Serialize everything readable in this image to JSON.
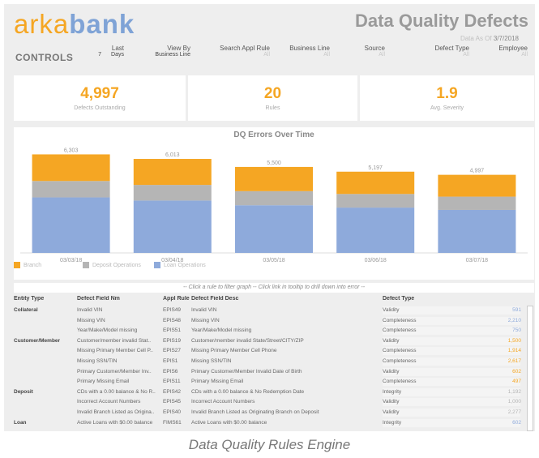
{
  "brand": {
    "part1": "arka",
    "part2": "bank"
  },
  "header": {
    "title": "Data Quality Defects",
    "asof_label": "Data As Of",
    "asof_value": "3/7/2018"
  },
  "controls": {
    "label": "CONTROLS",
    "last": {
      "label": "Last",
      "num": "7",
      "value": "Days"
    },
    "view_by": {
      "label": "View By",
      "value": "Business Line"
    },
    "search_rule": {
      "label": "Search Appl Rule",
      "value": "All"
    },
    "business_line": {
      "label": "Business Line",
      "value": "All"
    },
    "source": {
      "label": "Source",
      "value": "All"
    },
    "defect_type": {
      "label": "Defect Type",
      "value": "All"
    },
    "employee": {
      "label": "Employee",
      "value": "All"
    }
  },
  "kpis": [
    {
      "value": "4,997",
      "label": "Defects Outstanding"
    },
    {
      "value": "20",
      "label": "Rules"
    },
    {
      "value": "1.9",
      "label": "Avg. Severity"
    }
  ],
  "chart_data": {
    "type": "bar",
    "stacked": true,
    "title": "DQ Errors Over Time",
    "categories": [
      "03/03/18",
      "03/04/18",
      "03/05/18",
      "03/06/18",
      "03/07/18"
    ],
    "totals": [
      "6,303",
      "6,013",
      "5,500",
      "5,197",
      "4,997"
    ],
    "series": [
      {
        "name": "Loan Operations",
        "color": "#8eaadb",
        "values": [
          3550,
          3350,
          3050,
          2900,
          2750
        ]
      },
      {
        "name": "Deposit Operations",
        "color": "#b5b5b5",
        "values": [
          1050,
          1000,
          900,
          870,
          850
        ]
      },
      {
        "name": "Branch",
        "color": "#f5a623",
        "values": [
          1703,
          1663,
          1550,
          1427,
          1397
        ]
      }
    ],
    "ylim": [
      0,
      7000
    ]
  },
  "hint": "-- Click a rule to filter graph -- Click link in tooltip to drill down into error --",
  "table": {
    "headers": [
      "Entity Type",
      "Defect Field Nm",
      "Appl Rule",
      "Defect Field Desc",
      "Defect Type"
    ],
    "rows": [
      {
        "entity": "Collateral",
        "field": "Invalid VIN",
        "rule": "EPIS49",
        "desc": "Invalid VIN",
        "type": "Validity",
        "value": "591",
        "color": "#8eaadb",
        "frac": 0.12
      },
      {
        "entity": "",
        "field": "Missing VIN",
        "rule": "EPIS48",
        "desc": "Missing VIN",
        "type": "Completeness",
        "value": "2,210",
        "color": "#8eaadb",
        "frac": 0.45
      },
      {
        "entity": "",
        "field": "Year/Make/Model missing",
        "rule": "EPIS51",
        "desc": "Year/Make/Model missing",
        "type": "Completeness",
        "value": "750",
        "color": "#8eaadb",
        "frac": 0.15
      },
      {
        "entity": "Customer/Member",
        "field": "Customer/member invalid Stat..",
        "rule": "EPIS19",
        "desc": "Customer/member invalid State/Street/CITY/ZIP",
        "type": "Validity",
        "value": "1,500",
        "color": "#f5a623",
        "frac": 0.3
      },
      {
        "entity": "",
        "field": "Missing Primary Member Cell P..",
        "rule": "EPIS27",
        "desc": "Missing Primary Member Cell Phone",
        "type": "Completeness",
        "value": "1,914",
        "color": "#f5a623",
        "frac": 0.39
      },
      {
        "entity": "",
        "field": "Missing SSN/TIN",
        "rule": "EPIS1",
        "desc": "Missing SSN/TIN",
        "type": "Completeness",
        "value": "2,617",
        "color": "#f5a623",
        "frac": 0.53
      },
      {
        "entity": "",
        "field": "Primary Customer/Member Inv..",
        "rule": "EPIS6",
        "desc": "Primary Customer/Member Invalid Date of Birth",
        "type": "Validity",
        "value": "602",
        "color": "#f5a623",
        "frac": 0.12
      },
      {
        "entity": "",
        "field": "Primary Missing Email",
        "rule": "EPIS11",
        "desc": "Primary Missing Email",
        "type": "Completeness",
        "value": "497",
        "color": "#f5a623",
        "frac": 0.1
      },
      {
        "entity": "Deposit",
        "field": "CDs with a 0.00 balance & No R..",
        "rule": "EPIS42",
        "desc": "CDs with a 0.00 balance & No Redemption Date",
        "type": "Integrity",
        "value": "1,192",
        "color": "#b5b5b5",
        "frac": 0.24
      },
      {
        "entity": "",
        "field": "Incorrect Account Numbers",
        "rule": "EPIS45",
        "desc": "Incorrect Account Numbers",
        "type": "Validity",
        "value": "1,000",
        "color": "#b5b5b5",
        "frac": 0.2
      },
      {
        "entity": "",
        "field": "Invalid Branch Listed as Origina..",
        "rule": "EPIS40",
        "desc": "Invalid Branch Listed as Originating Branch on Deposit",
        "type": "Validity",
        "value": "2,277",
        "color": "#b5b5b5",
        "frac": 0.46
      },
      {
        "entity": "Loan",
        "field": "Active Loans with $0.00 balance",
        "rule": "FIMS61",
        "desc": "Active Loans with $0.00 balance",
        "type": "Integrity",
        "value": "602",
        "color": "#8eaadb",
        "frac": 0.12
      }
    ]
  },
  "caption": "Data Quality Rules Engine"
}
